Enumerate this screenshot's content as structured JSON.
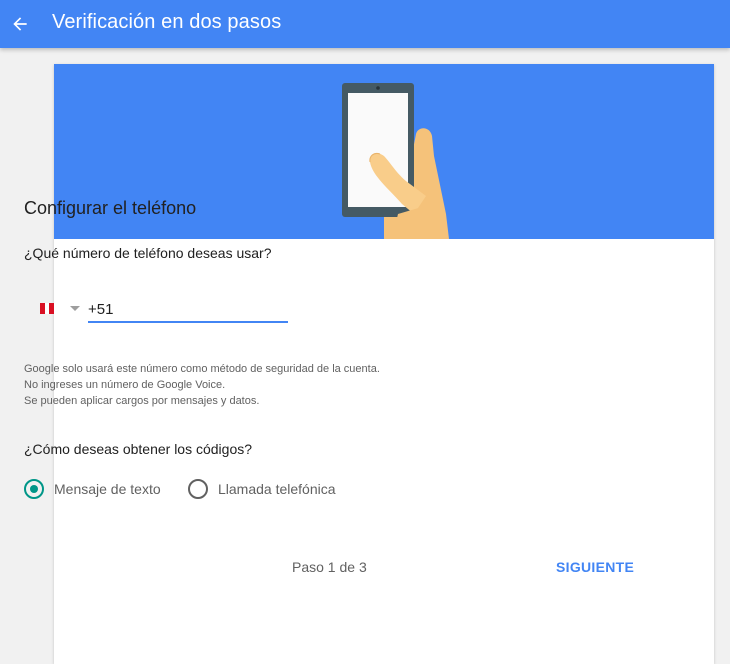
{
  "appbar": {
    "title": "Verificación en dos pasos",
    "back_icon": "arrow-left-icon"
  },
  "hero": {
    "illustration": "phone-in-hand-illustration"
  },
  "form": {
    "section_title": "Configurar el teléfono",
    "phone_question": "¿Qué número de teléfono deseas usar?",
    "country_flag": "peru-flag-icon",
    "phone_value": "+51",
    "helper_lines": [
      "Google solo usará este número como método de seguridad de la cuenta.",
      "No ingreses un número de Google Voice.",
      "Se pueden aplicar cargos por mensajes y datos."
    ],
    "codes_question": "¿Cómo deseas obtener los códigos?",
    "options": [
      {
        "label": "Mensaje de texto",
        "checked": true
      },
      {
        "label": "Llamada telefónica",
        "checked": false
      }
    ]
  },
  "footer": {
    "step": "Paso 1 de 3",
    "next_label": "SIGUIENTE"
  },
  "colors": {
    "primary": "#4285f4",
    "radio_accent": "#009688"
  }
}
